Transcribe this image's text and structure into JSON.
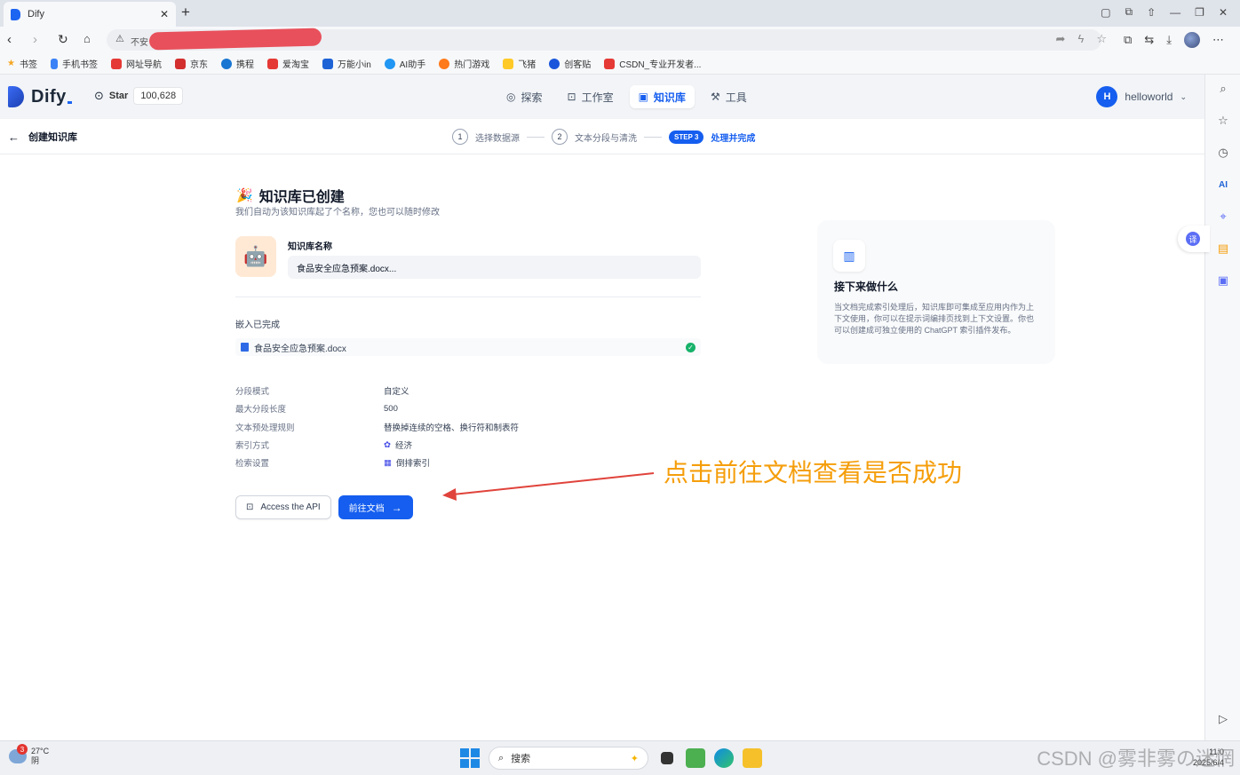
{
  "browser": {
    "tab_title": "Dify",
    "address_insecure": "不安",
    "bookmarks": [
      "书签",
      "手机书签",
      "网址导航",
      "京东",
      "携程",
      "爱淘宝",
      "万能小in",
      "AI助手",
      "热门游戏",
      "飞猪",
      "创客贴",
      "CSDN_专业开发者..."
    ]
  },
  "header": {
    "brand": "Dify",
    "star_label": "Star",
    "star_count": "100,628",
    "nav": [
      {
        "label": "探索",
        "icon": "compass-icon"
      },
      {
        "label": "工作室",
        "icon": "robot-icon"
      },
      {
        "label": "知识库",
        "icon": "book-icon"
      },
      {
        "label": "工具",
        "icon": "tool-icon"
      }
    ],
    "active_nav": "知识库",
    "user_initial": "H",
    "user_name": "helloworld"
  },
  "subheader": {
    "back_label": "创建知识库",
    "steps": [
      {
        "num": "1",
        "label": "选择数据源"
      },
      {
        "num": "2",
        "label": "文本分段与清洗"
      },
      {
        "num": "STEP 3",
        "label": "处理并完成"
      }
    ]
  },
  "main": {
    "title": "知识库已创建",
    "subtitle": "我们自动为该知识库起了个名称，您也可以随时修改",
    "name_label": "知识库名称",
    "name_value": "食品安全应急预案.docx...",
    "embed_label": "嵌入已完成",
    "file_name": "食品安全应急预案.docx",
    "props": [
      {
        "key": "分段模式",
        "value": "自定义"
      },
      {
        "key": "最大分段长度",
        "value": "500"
      },
      {
        "key": "文本预处理规则",
        "value": "替换掉连续的空格、换行符和制表符"
      },
      {
        "key": "索引方式",
        "value": "经济"
      },
      {
        "key": "检索设置",
        "value": "倒排索引"
      }
    ],
    "api_button": "Access the API",
    "docs_button": "前往文档"
  },
  "next_card": {
    "title": "接下来做什么",
    "desc": "当文档完成索引处理后，知识库即可集成至应用内作为上下文使用，你可以在提示词编排页找到上下文设置。你也可以创建成可独立使用的 ChatGPT 索引插件发布。"
  },
  "annotation": "点击前往文档查看是否成功",
  "taskbar": {
    "temp": "27°C",
    "weather": "阴",
    "weather_badge": "3",
    "search": "搜索",
    "watermark": "CSDN @雾非雾の迷惘",
    "time": "11:0",
    "date": "2025/6/4"
  },
  "colors": {
    "primary": "#155eef",
    "annotation": "#f59e0b",
    "arrow": "#e0433b"
  }
}
